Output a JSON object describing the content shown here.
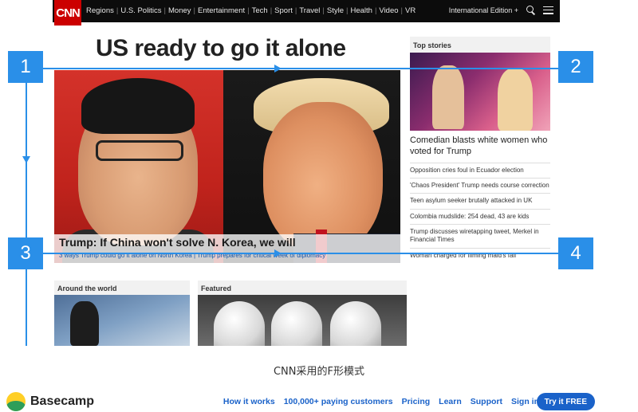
{
  "cnn": {
    "logo": "CNN",
    "nav": [
      "Regions",
      "U.S. Politics",
      "Money",
      "Entertainment",
      "Tech",
      "Sport",
      "Travel",
      "Style",
      "Health",
      "Video",
      "VR"
    ],
    "edition": "International Edition +",
    "headline": "US ready to go it alone",
    "hero": {
      "title": "Trump: If China won't solve N. Korea, we will",
      "subtitle": "3 ways Trump could go it alone on North Korea | Trump prepares for critical week of diplomacy"
    },
    "top_stories": {
      "header": "Top stories",
      "feature": "Comedian blasts white women who voted for Trump",
      "items": [
        "Opposition cries foul in Ecuador election",
        "'Chaos President' Trump needs course correction",
        "Teen asylum seeker brutally attacked in UK",
        "Colombia mudslide: 254 dead, 43 are kids",
        "Trump discusses wiretapping tweet, Merkel in Financial Times",
        "Woman charged for filming maid's fall"
      ]
    },
    "sections": {
      "world": "Around the world",
      "featured": "Featured"
    }
  },
  "annotations": [
    "1",
    "2",
    "3",
    "4"
  ],
  "caption": "CNN采用的F形模式",
  "basecamp": {
    "name": "Basecamp",
    "links": [
      "How it works",
      "100,000+ paying customers",
      "Pricing",
      "Learn",
      "Support",
      "Sign in"
    ],
    "cta": "Try it FREE"
  },
  "colors": {
    "cnn_red": "#cc0000",
    "annotation_blue": "#2a8fe8",
    "link_blue": "#1a62c9"
  }
}
